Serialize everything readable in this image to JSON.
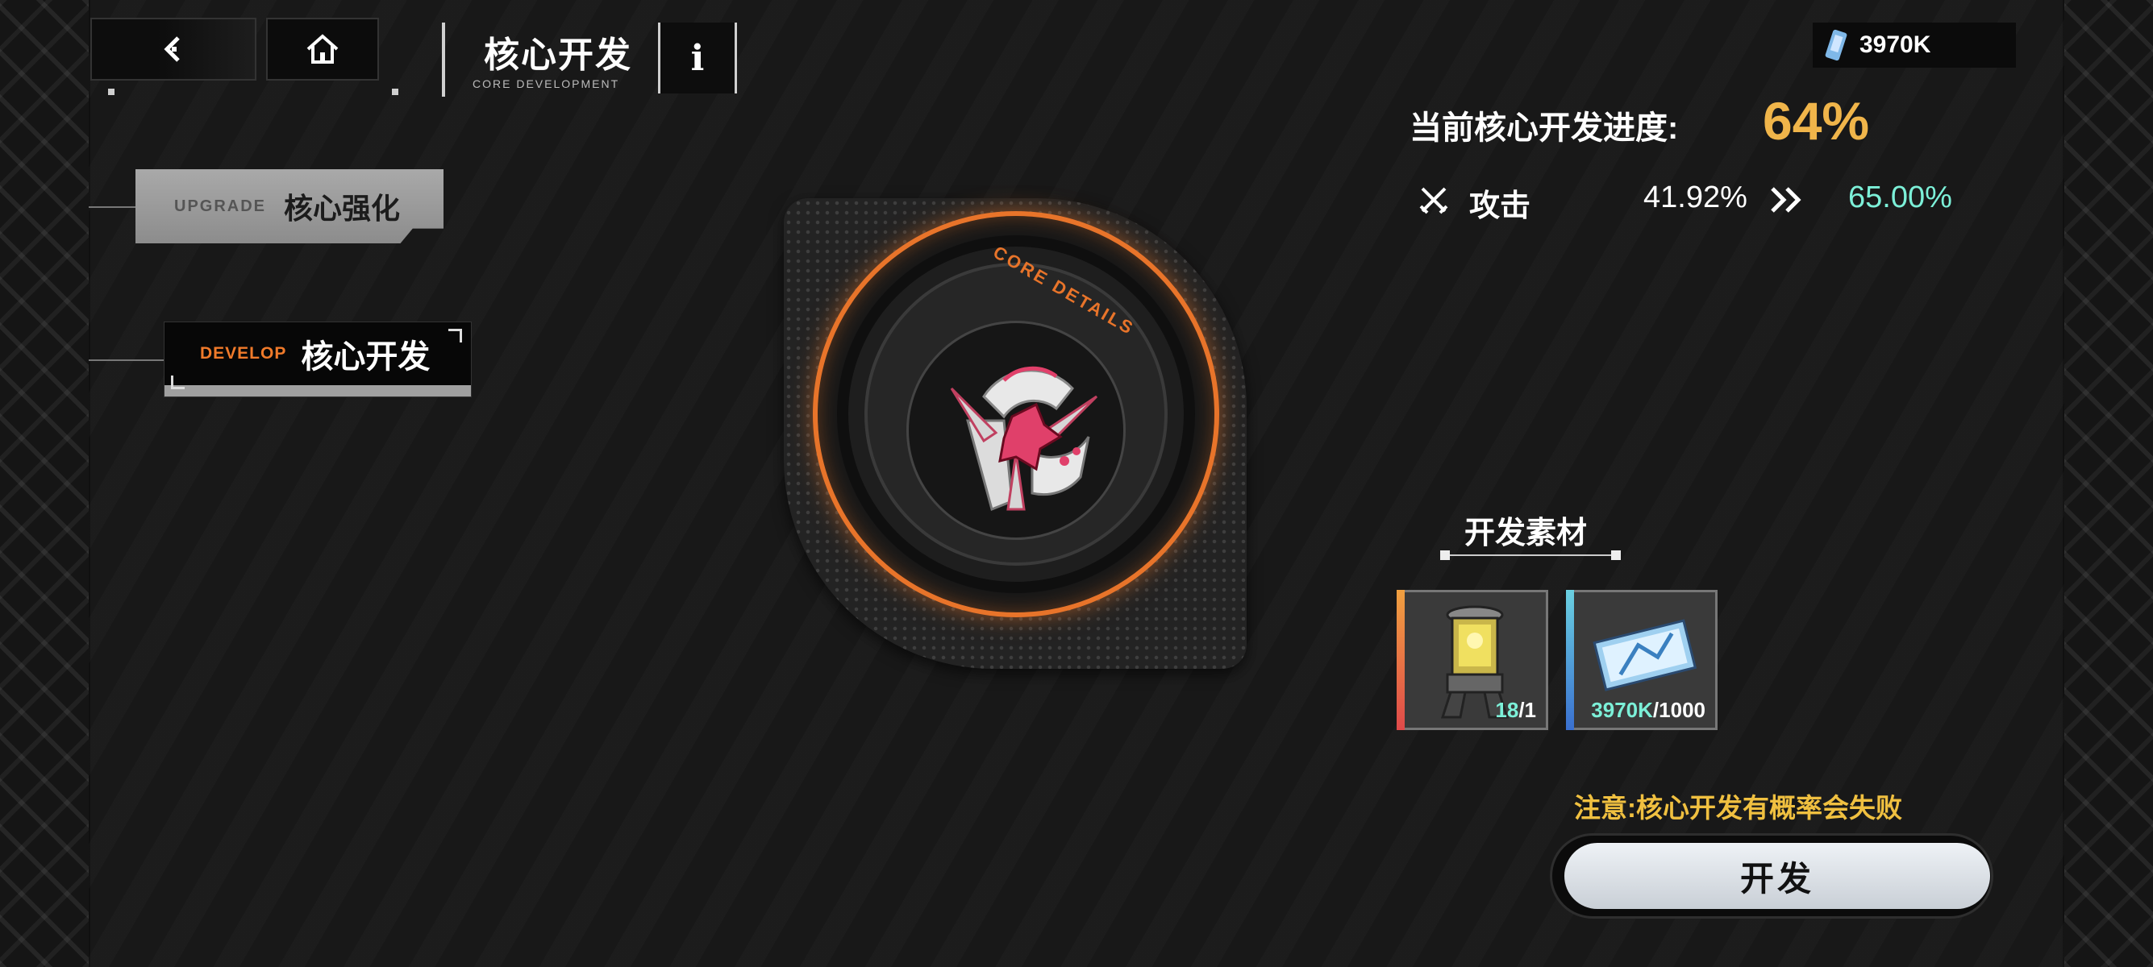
{
  "header": {
    "title": "核心开发",
    "subtitle": "CORE DEVELOPMENT",
    "info_label": "i",
    "currency_value": "3970K"
  },
  "tabs": [
    {
      "en": "UPGRADE",
      "cn": "核心强化",
      "active": false
    },
    {
      "en": "DEVELOP",
      "cn": "核心开发",
      "active": true
    }
  ],
  "core": {
    "ring_label": "CORE DETAILS",
    "accent_color": "#e8742a"
  },
  "progress": {
    "label": "当前核心开发进度:",
    "value": "64%"
  },
  "stat": {
    "name": "攻击",
    "current": "41.92%",
    "next": "65.00%",
    "icon": "crossed-swords-icon"
  },
  "materials": {
    "title": "开发素材",
    "items": [
      {
        "icon": "core-capsule-icon",
        "owned": "18",
        "required": "/1",
        "stripe_color": "#e06a3a"
      },
      {
        "icon": "ticket-icon",
        "owned": "3970K",
        "required": "/1000",
        "stripe_color": "#4ab0d8"
      }
    ]
  },
  "warning": "注意:核心开发有概率会失败",
  "develop_button": "开发",
  "colors": {
    "progress": "#f0b54a",
    "next_value": "#7cf0d8",
    "warning": "#f0c040"
  }
}
